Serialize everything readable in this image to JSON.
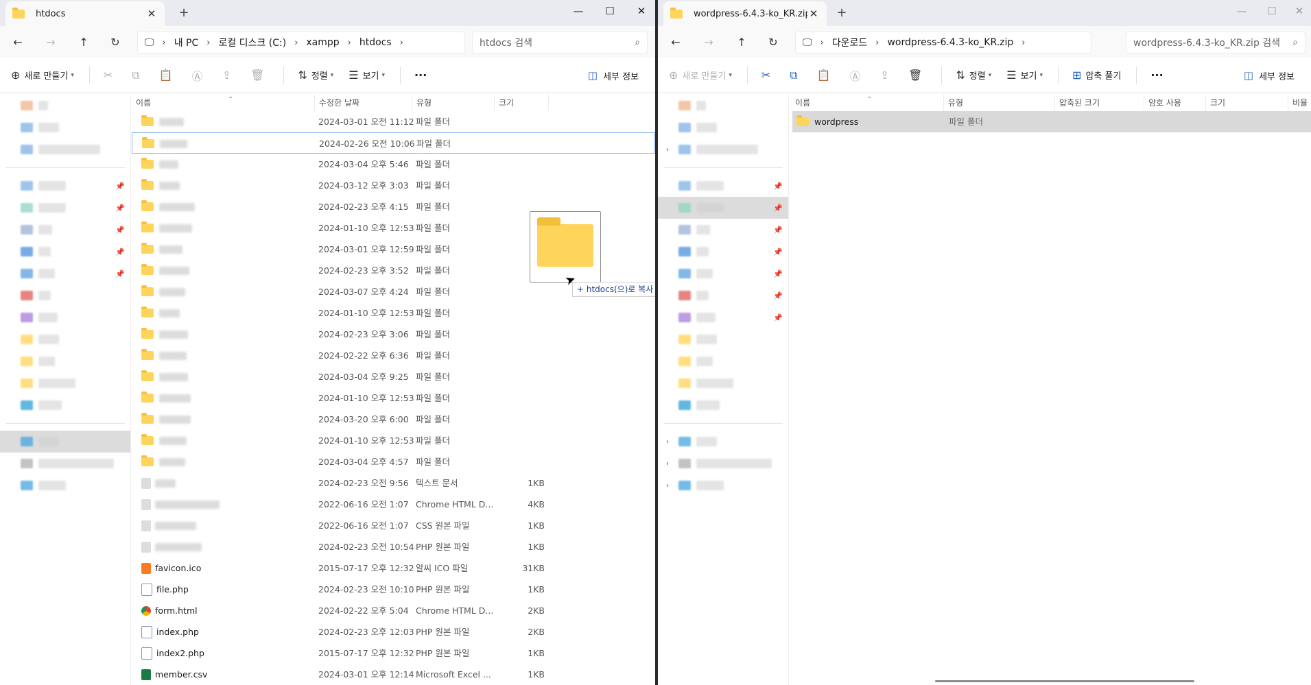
{
  "left": {
    "tab_title": "htdocs",
    "close": "✕",
    "new_tab": "+",
    "window": {
      "minimize": "—",
      "maximize": "☐",
      "close": "✕"
    },
    "breadcrumb": [
      "내 PC",
      "로컬 디스크 (C:)",
      "xampp",
      "htdocs"
    ],
    "search_placeholder": "htdocs 검색",
    "commands": {
      "new": "새로 만들기",
      "sort": "정렬",
      "view": "보기",
      "more": "···",
      "details": "세부 정보"
    },
    "columns": {
      "name": "이름",
      "modified": "수정한 날짜",
      "type": "유형",
      "size": "크기"
    },
    "folder_rows": [
      {
        "date": "2024-03-01 오전 11:12",
        "type": "파일 폴더"
      },
      {
        "date": "2024-02-26 오전 10:06",
        "type": "파일 폴더"
      },
      {
        "date": "2024-03-04 오후 5:46",
        "type": "파일 폴더"
      },
      {
        "date": "2024-03-12 오후 3:03",
        "type": "파일 폴더"
      },
      {
        "date": "2024-02-23 오후 4:15",
        "type": "파일 폴더"
      },
      {
        "date": "2024-01-10 오후 12:53",
        "type": "파일 폴더"
      },
      {
        "date": "2024-03-01 오후 12:59",
        "type": "파일 폴더"
      },
      {
        "date": "2024-02-23 오후 3:52",
        "type": "파일 폴더"
      },
      {
        "date": "2024-03-07 오후 4:24",
        "type": "파일 폴더"
      },
      {
        "date": "2024-01-10 오후 12:53",
        "type": "파일 폴더"
      },
      {
        "date": "2024-02-23 오후 3:06",
        "type": "파일 폴더"
      },
      {
        "date": "2024-02-22 오후 6:36",
        "type": "파일 폴더"
      },
      {
        "date": "2024-03-04 오후 9:25",
        "type": "파일 폴더"
      },
      {
        "date": "2024-01-10 오후 12:53",
        "type": "파일 폴더"
      },
      {
        "date": "2024-03-20 오후 6:00",
        "type": "파일 폴더"
      },
      {
        "date": "2024-01-10 오후 12:53",
        "type": "파일 폴더"
      },
      {
        "date": "2024-03-04 오후 4:57",
        "type": "파일 폴더"
      }
    ],
    "file_rows_blurred": [
      {
        "date": "2024-02-23 오전 9:56",
        "type": "텍스트 문서",
        "size": "1KB"
      },
      {
        "date": "2022-06-16 오전 1:07",
        "type": "Chrome HTML D...",
        "size": "4KB"
      },
      {
        "date": "2022-06-16 오전 1:07",
        "type": "CSS 원본 파일",
        "size": "1KB"
      },
      {
        "date": "2024-02-23 오전 10:54",
        "type": "PHP 원본 파일",
        "size": "1KB"
      }
    ],
    "file_rows": [
      {
        "name": "favicon.ico",
        "date": "2015-07-17 오후 12:32",
        "type": "알씨 ICO 파일",
        "size": "31KB",
        "icon": "xampp-icon"
      },
      {
        "name": "file.php",
        "date": "2024-02-23 오전 10:10",
        "type": "PHP 원본 파일",
        "size": "1KB",
        "icon": "php-file-icon"
      },
      {
        "name": "form.html",
        "date": "2024-02-22 오후 5:04",
        "type": "Chrome HTML D...",
        "size": "2KB",
        "icon": "chrome-icon"
      },
      {
        "name": "index.php",
        "date": "2024-02-23 오후 12:03",
        "type": "PHP 원본 파일",
        "size": "2KB",
        "icon": "php-file-icon"
      },
      {
        "name": "index2.php",
        "date": "2015-07-17 오후 12:32",
        "type": "PHP 원본 파일",
        "size": "1KB",
        "icon": "php-file-icon"
      },
      {
        "name": "member.csv",
        "date": "2024-03-01 오후 12:14",
        "type": "Microsoft Excel ...",
        "size": "1KB",
        "icon": "excel-icon"
      }
    ],
    "drag_tooltip": "+ htdocs(으)로 복사"
  },
  "right": {
    "tab_title": "wordpress-6.4.3-ko_KR.zip",
    "close": "✕",
    "new_tab": "+",
    "window": {
      "minimize": "—",
      "maximize": "☐",
      "close": "✕"
    },
    "breadcrumb": [
      "다운로드",
      "wordpress-6.4.3-ko_KR.zip"
    ],
    "search_placeholder": "wordpress-6.4.3-ko_KR.zip 검색",
    "commands": {
      "new": "새로 만들기",
      "sort": "정렬",
      "view": "보기",
      "extract": "압축 풀기",
      "more": "···",
      "details": "세부 정보"
    },
    "columns": {
      "name": "이름",
      "type": "유형",
      "compressed": "압축된 크기",
      "password": "암호 사용",
      "size": "크기",
      "ratio": "비율"
    },
    "rows": [
      {
        "name": "wordpress",
        "type": "파일 폴더"
      }
    ]
  },
  "colors": {
    "folder": "#ffd45a",
    "accent": "#1f5fbf",
    "selection_border": "#8ab4e8"
  }
}
